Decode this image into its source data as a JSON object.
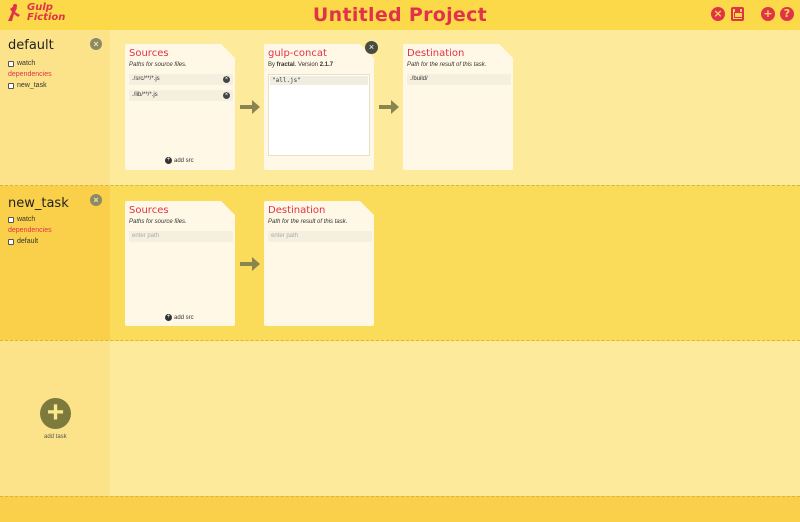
{
  "app": {
    "logo_text_line1": "Gulp",
    "logo_text_line2": "Fiction",
    "title": "Untitled Project",
    "accent_color": "#e0334a",
    "header_icons": [
      "close-icon",
      "save-icon",
      "add-icon",
      "help-icon"
    ]
  },
  "tasks": [
    {
      "name": "default",
      "options": [
        {
          "label": "watch",
          "checked": false
        },
        {
          "label": "new_task",
          "checked": false
        }
      ],
      "dependencies_label": "dependencies",
      "sources": {
        "title": "Sources",
        "subtitle": "Paths for source files.",
        "paths": [
          "./src/**/*.js",
          "./lib/**/*.js"
        ],
        "add_label": "add src"
      },
      "plugin": {
        "title": "gulp-concat",
        "by_prefix": "By ",
        "author": "fractal",
        "version_prefix": ". Version ",
        "version": "2.1.7",
        "code": "\"all.js\""
      },
      "destination": {
        "title": "Destination",
        "subtitle": "Path for the result of this task.",
        "path": "./build/"
      }
    },
    {
      "name": "new_task",
      "options": [
        {
          "label": "watch",
          "checked": false
        },
        {
          "label": "default",
          "checked": false
        }
      ],
      "dependencies_label": "dependencies",
      "sources": {
        "title": "Sources",
        "subtitle": "Paths for source files.",
        "placeholder": "enter path",
        "add_label": "add src"
      },
      "destination": {
        "title": "Destination",
        "subtitle": "Path for the result of this task.",
        "placeholder": "enter path"
      }
    }
  ],
  "add_task_label": "add task"
}
